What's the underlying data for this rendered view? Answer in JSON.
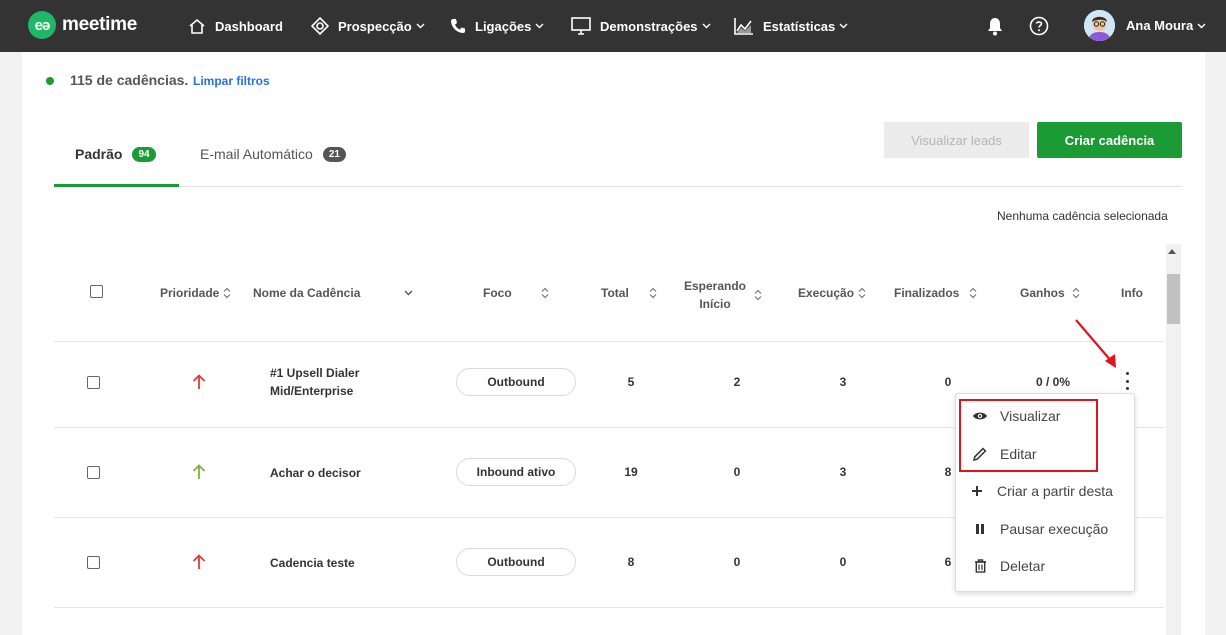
{
  "nav": {
    "logo_mark": "eə",
    "logo_text": "meetime",
    "items": [
      {
        "label": "Dashboard",
        "icon": "home-icon",
        "has_dropdown": false
      },
      {
        "label": "Prospecção",
        "icon": "target-icon",
        "has_dropdown": true
      },
      {
        "label": "Ligações",
        "icon": "phone-icon",
        "has_dropdown": true
      },
      {
        "label": "Demonstrações",
        "icon": "monitor-icon",
        "has_dropdown": true
      },
      {
        "label": "Estatísticas",
        "icon": "chart-icon",
        "has_dropdown": true
      }
    ],
    "notification_icon": "bell-icon",
    "help_icon": "help-icon",
    "user_name": "Ana Moura"
  },
  "summary": {
    "count_text": "115 de cadências.",
    "clear_filters": "Limpar filtros"
  },
  "tabs": [
    {
      "label": "Padrão",
      "count": "94",
      "active": true
    },
    {
      "label": "E-mail Automático",
      "count": "21",
      "active": false
    }
  ],
  "actions": {
    "view_leads": "Visualizar leads",
    "create_cadence": "Criar cadência"
  },
  "selection_status": "Nenhuma cadência selecionada",
  "table": {
    "headers": {
      "priority": "Prioridade",
      "name": "Nome da Cadência",
      "focus": "Foco",
      "total": "Total",
      "waiting_line1": "Esperando",
      "waiting_line2": "Início",
      "execution": "Execução",
      "finished": "Finalizados",
      "gains": "Ganhos",
      "info": "Info"
    },
    "rows": [
      {
        "priority": "high",
        "name": "#1 Upsell Dialer Mid/Enterprise",
        "focus": "Outbound",
        "total": "5",
        "waiting": "2",
        "execution": "3",
        "finished": "0",
        "gains": "0 / 0%"
      },
      {
        "priority": "low",
        "name": "Achar o decisor",
        "focus": "Inbound ativo",
        "total": "19",
        "waiting": "0",
        "execution": "3",
        "finished": "8",
        "gains": ""
      },
      {
        "priority": "high",
        "name": "Cadencia teste",
        "focus": "Outbound",
        "total": "8",
        "waiting": "0",
        "execution": "0",
        "finished": "6",
        "gains": ""
      }
    ]
  },
  "context_menu": {
    "items": [
      {
        "label": "Visualizar",
        "icon": "eye-icon"
      },
      {
        "label": "Editar",
        "icon": "pencil-icon"
      },
      {
        "label": "Criar a partir desta",
        "icon": "plus-icon"
      },
      {
        "label": "Pausar execução",
        "icon": "pause-icon"
      },
      {
        "label": "Deletar",
        "icon": "trash-icon"
      }
    ]
  },
  "colors": {
    "topbar": "#333333",
    "brand_green": "#1a9b33",
    "link_blue": "#2a6fdb",
    "priority_high": "#e53935",
    "priority_low": "#7cb342",
    "annotation_red": "#e0141e"
  }
}
